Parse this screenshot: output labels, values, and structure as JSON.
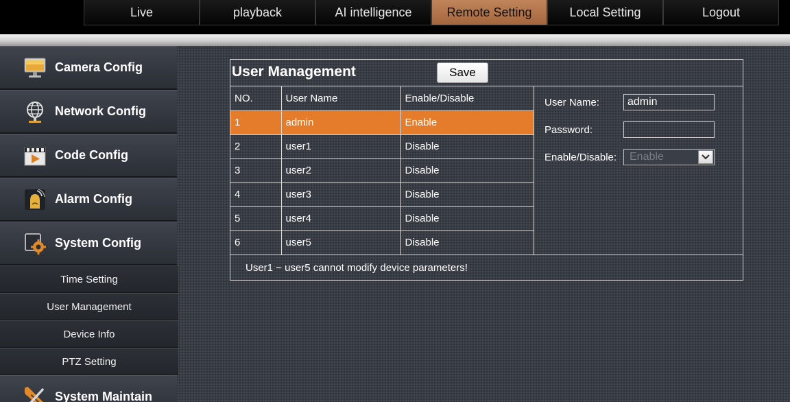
{
  "nav": {
    "tabs": [
      {
        "label": "Live"
      },
      {
        "label": "playback"
      },
      {
        "label": "AI intelligence"
      },
      {
        "label": "Remote Setting"
      },
      {
        "label": "Local Setting"
      },
      {
        "label": "Logout"
      }
    ],
    "active_tab": "Remote Setting"
  },
  "sidebar": {
    "sections": [
      {
        "label": "Camera Config",
        "icon": "monitor-icon"
      },
      {
        "label": "Network Config",
        "icon": "globe-network-icon"
      },
      {
        "label": "Code Config",
        "icon": "video-clapper-icon"
      },
      {
        "label": "Alarm Config",
        "icon": "alarm-siren-icon"
      },
      {
        "label": "System Config",
        "icon": "gear-config-icon"
      }
    ],
    "sub_items": [
      {
        "label": "Time Setting"
      },
      {
        "label": "User Management"
      },
      {
        "label": "Device Info"
      },
      {
        "label": "PTZ Setting"
      }
    ],
    "bottom_section": {
      "label": "System Maintain",
      "icon": "wrench-tools-icon"
    }
  },
  "panel": {
    "title": "User Management",
    "save_label": "Save",
    "table": {
      "headers": [
        "NO.",
        "User Name",
        "Enable/Disable"
      ],
      "rows": [
        {
          "no": "1",
          "name": "admin",
          "status": "Enable"
        },
        {
          "no": "2",
          "name": "user1",
          "status": "Disable"
        },
        {
          "no": "3",
          "name": "user2",
          "status": "Disable"
        },
        {
          "no": "4",
          "name": "user3",
          "status": "Disable"
        },
        {
          "no": "5",
          "name": "user4",
          "status": "Disable"
        },
        {
          "no": "6",
          "name": "user5",
          "status": "Disable"
        }
      ],
      "selected_row": 0
    },
    "form": {
      "username_label": "User Name:",
      "username_value": "admin",
      "password_label": "Password:",
      "password_value": "",
      "enable_label": "Enable/Disable:",
      "enable_value": "Enable"
    },
    "note": "User1 ~ user5 cannot modify device parameters!"
  },
  "colors": {
    "accent_orange": "#e47c2c",
    "active_tab": "#b8774b",
    "background": "#3a3e46"
  }
}
